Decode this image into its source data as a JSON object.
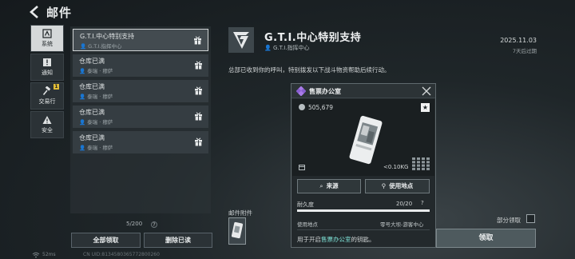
{
  "header": {
    "title": "邮件"
  },
  "sidebar": {
    "items": [
      {
        "label": "系统",
        "icon": "system-icon",
        "active": true
      },
      {
        "label": "通知",
        "icon": "notice-icon",
        "active": false
      },
      {
        "label": "交易行",
        "icon": "gavel-icon",
        "active": false,
        "badge": "1"
      },
      {
        "label": "安全",
        "icon": "warning-icon",
        "active": false
      }
    ]
  },
  "mail_list": {
    "items": [
      {
        "title": "G.T.I.中心特别支持",
        "sender": "G.T.I.指挥中心",
        "selected": true
      },
      {
        "title": "仓库已满",
        "sender": "泰瑞 · 穆萨",
        "selected": false
      },
      {
        "title": "仓库已满",
        "sender": "泰瑞 · 穆萨",
        "selected": false
      },
      {
        "title": "仓库已满",
        "sender": "泰瑞 · 穆萨",
        "selected": false
      },
      {
        "title": "仓库已满",
        "sender": "泰瑞 · 穆萨",
        "selected": false
      }
    ],
    "count": "5/200",
    "help": "?",
    "claim_all_label": "全部领取",
    "delete_read_label": "删除已读"
  },
  "detail": {
    "title": "G.T.I.中心特别支持",
    "sender": "G.T.I.指挥中心",
    "date": "2025.11.03",
    "expire": "7天后过期",
    "body": "总部已收到你的呼叫，特别拨发以下战斗物资帮助后续行动。",
    "attachments_label": "邮件附件",
    "partial_claim_label": "部分领取",
    "claim_label": "领取"
  },
  "popup": {
    "title": "售票办公室",
    "value": "505,679",
    "star": "★",
    "weight": "<0.10KG",
    "source_label": "来源",
    "use_place_button_label": "使用地点",
    "durability_label": "耐久度",
    "durability_value": "20/20",
    "durability_help": "?",
    "durability_fraction": 1.0,
    "use_place_label": "使用地点",
    "use_place_value": "零号大坝-游客中心",
    "desc_prefix": "用于开启",
    "desc_highlight": "售票办公室",
    "desc_suffix": "的钥匙。"
  },
  "status": {
    "ping": "52ms",
    "uid": "CN UID:8134580365772800260"
  },
  "colors": {
    "highlight": "#7fe3d8",
    "badge": "#e1bd37",
    "active_nav": "#d5d8d9"
  }
}
